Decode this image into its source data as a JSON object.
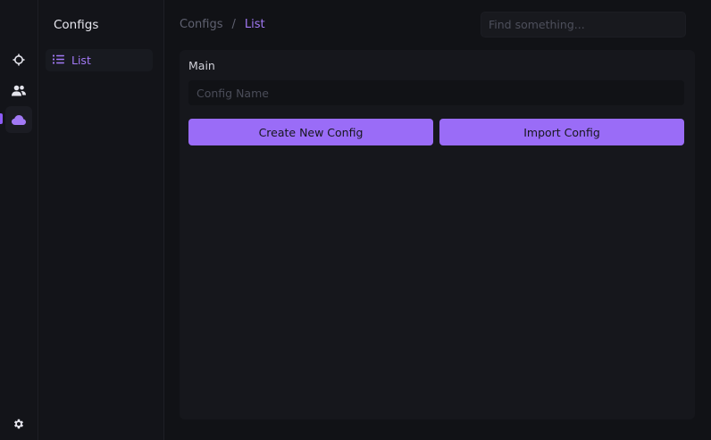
{
  "rail": {
    "items": [
      {
        "icon": "crosshair-icon",
        "active": false
      },
      {
        "icon": "users-icon",
        "active": false
      },
      {
        "icon": "cloud-icon",
        "active": true
      }
    ],
    "bottom_icon": "gear-icon"
  },
  "sidebar": {
    "title": "Configs",
    "items": [
      {
        "label": "List",
        "icon": "list-icon",
        "active": true
      }
    ]
  },
  "header": {
    "breadcrumb": [
      "Configs",
      "List"
    ],
    "separator": "/",
    "search": {
      "placeholder": "Find something...",
      "value": ""
    }
  },
  "main": {
    "section_title": "Main",
    "name_input": {
      "placeholder": "Config Name",
      "value": ""
    },
    "create_label": "Create New Config",
    "import_label": "Import Config"
  },
  "colors": {
    "accent": "#9a6cf7",
    "background": "#111216",
    "panel": "#16171c"
  }
}
